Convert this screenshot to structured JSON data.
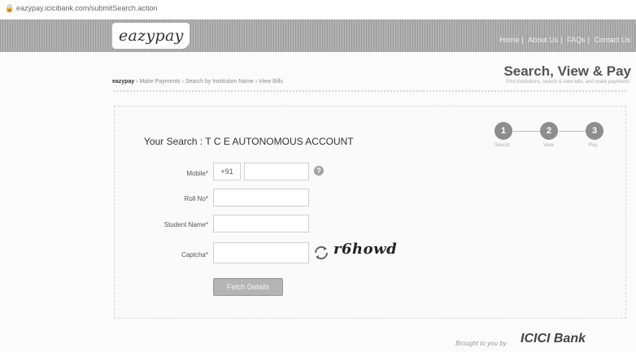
{
  "browser": {
    "url": "eazypay.icicibank.com/submitSearch.action"
  },
  "header": {
    "logo_text": "eazypay",
    "nav": [
      "Home",
      "About Us",
      "FAQs",
      "Contact Us"
    ]
  },
  "breadcrumb": {
    "root": "eazypay",
    "path": "› Make Payments › Search by Institution Name › View Bills"
  },
  "page": {
    "title": "Search, View & Pay",
    "subtitle": "Find institutions, search & view bills, and make payments"
  },
  "steps": [
    {
      "number": "1",
      "label": "Search"
    },
    {
      "number": "2",
      "label": "View"
    },
    {
      "number": "3",
      "label": "Pay"
    }
  ],
  "search": {
    "prefix": "Your Search : ",
    "institution": "T C E AUTONOMOUS ACCOUNT"
  },
  "form": {
    "mobile_label": "Mobile*",
    "country_code": "+91",
    "mobile_value": "",
    "help_icon": "?",
    "roll_label": "Roll No*",
    "roll_value": "",
    "student_label": "Student Name*",
    "student_value": "",
    "captcha_label": "Captcha*",
    "captcha_value": "",
    "captcha_text": "r6howd",
    "submit_label": "Fetch Details"
  },
  "footer": {
    "brought": "Brought to you by",
    "bank": "ICICI Bank"
  },
  "colors": {
    "step": "#8d8d8d",
    "button": "#b4b4b4"
  }
}
